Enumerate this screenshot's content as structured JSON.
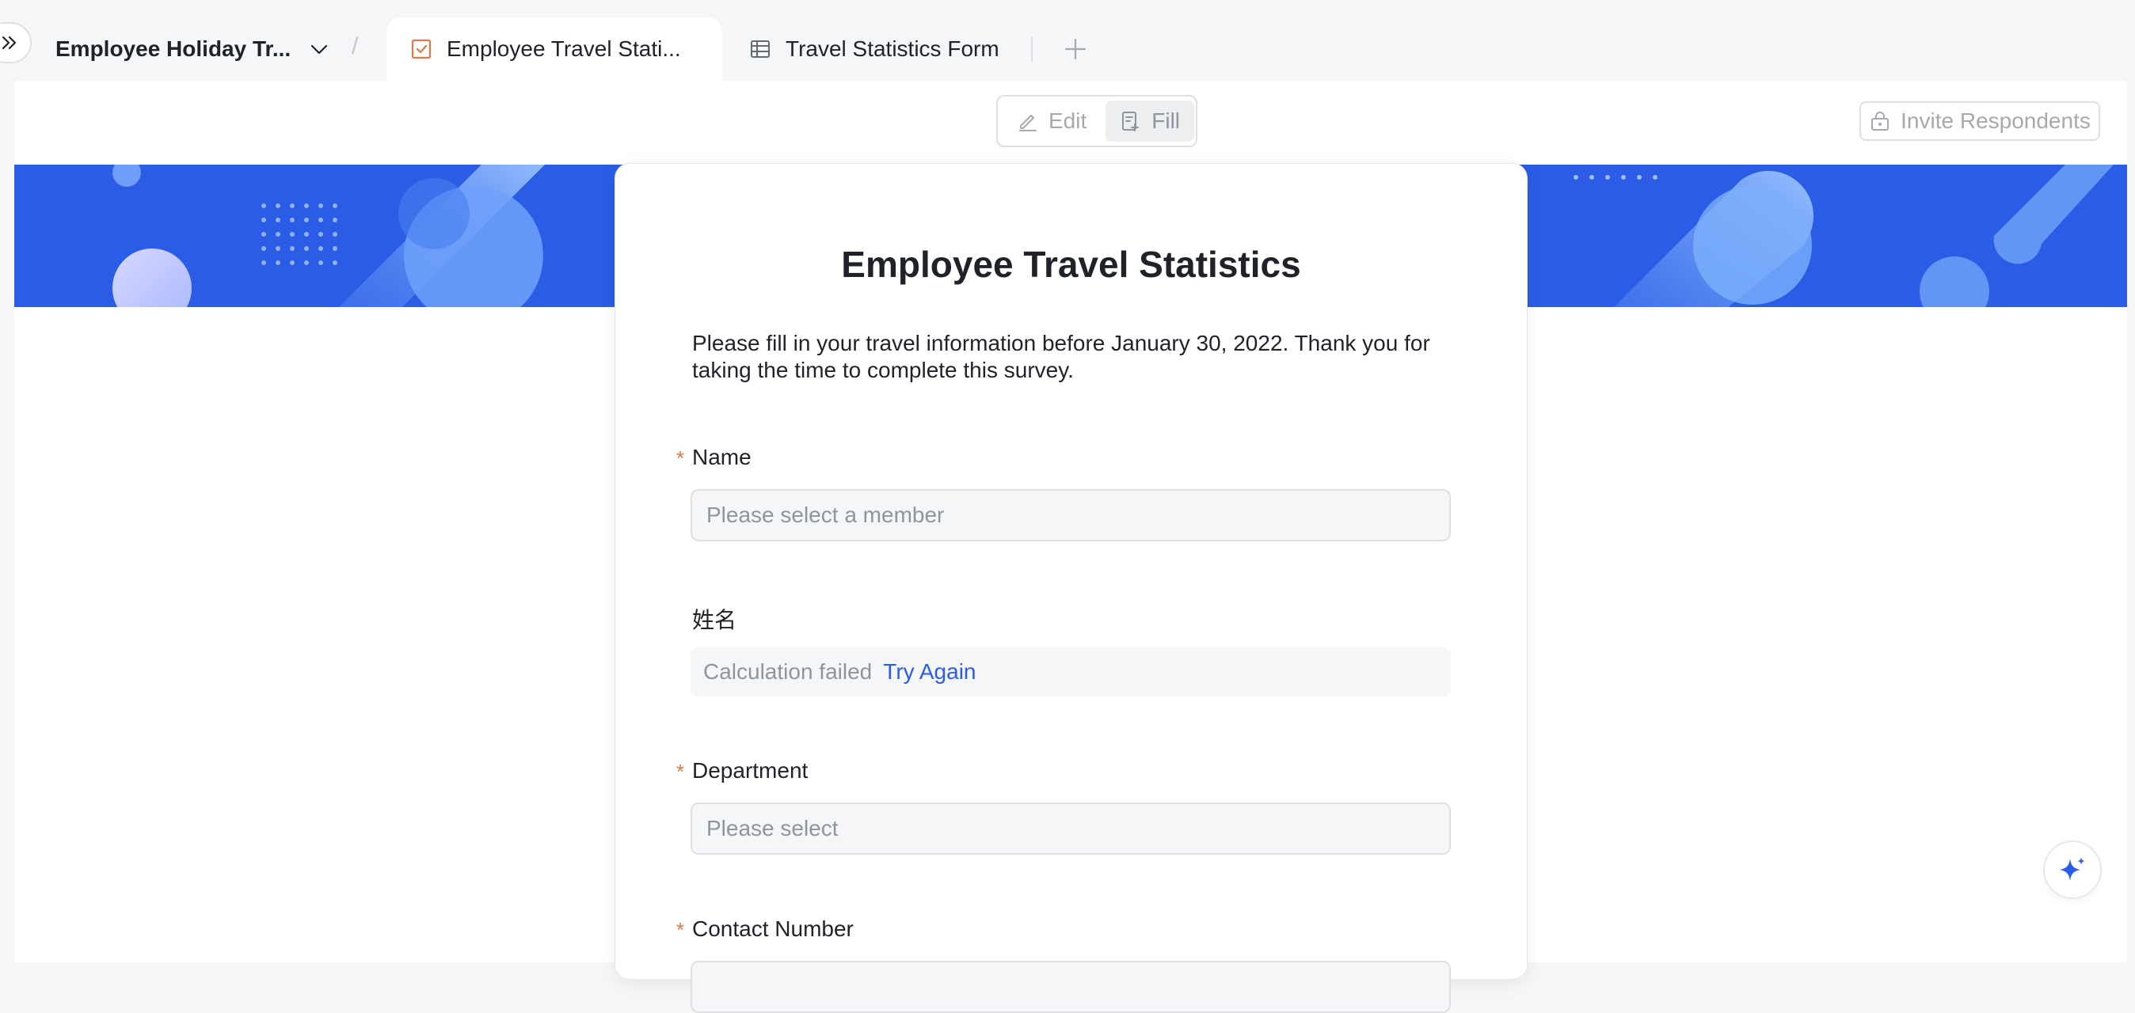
{
  "tabs": {
    "document_title": "Employee Holiday Tr...",
    "active_tab_label": "Employee Travel Stati...",
    "second_tab_label": "Travel Statistics Form"
  },
  "toolbar": {
    "edit_label": "Edit",
    "fill_label": "Fill",
    "active_mode": "Fill",
    "invite_label": "Invite Respondents"
  },
  "form": {
    "title": "Employee Travel Statistics",
    "description": "Please fill in your travel information before January 30, 2022. Thank you for taking the time to complete this survey.",
    "fields": [
      {
        "label": "Name",
        "required": true,
        "placeholder": "Please select a member"
      },
      {
        "label": "姓名",
        "required": false,
        "status": "Calculation failed",
        "action": "Try Again"
      },
      {
        "label": "Department",
        "required": true,
        "placeholder": "Please select"
      },
      {
        "label": "Contact Number",
        "required": true
      }
    ],
    "required_mark": "*"
  },
  "colors": {
    "banner": "#2b5ce5",
    "accent": "#2b5ce5",
    "required": "#d97a4a",
    "form_tab_icon": "#d97a4a"
  },
  "icons": {
    "collapse": "double-chevron-right-icon",
    "dropdown": "chevron-down-icon",
    "form_tab": "form-checkbox-icon",
    "table_tab": "table-grid-icon",
    "add_tab": "plus-icon",
    "edit": "pencil-icon",
    "fill": "form-fill-icon",
    "invite": "lock-icon",
    "ai": "sparkle-icon"
  }
}
